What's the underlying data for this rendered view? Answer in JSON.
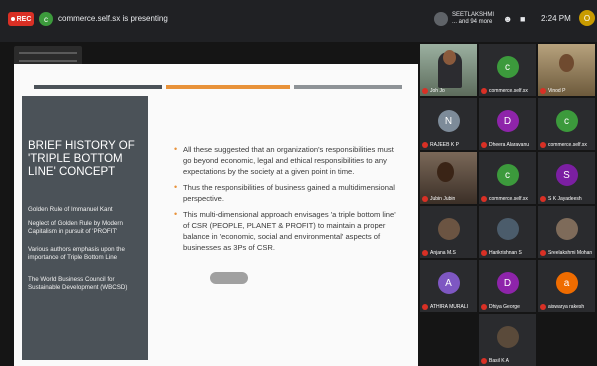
{
  "topbar": {
    "rec_label": "REC",
    "presenter_initial": "c",
    "presenting_text": "commerce.self.sx is presenting",
    "me_name": "SEETLAKSHMI ... and 94 more",
    "time": "2:24 PM",
    "corner_initial": "O"
  },
  "slide": {
    "title": "BRIEF HISTORY OF 'TRIPLE BOTTOM LINE' CONCEPT",
    "left_items": [
      "Golden Rule of Immanuel Kant",
      "Neglect of Golden Rule by Modern Capitalism in pursuit of 'PROFIT'",
      "Various authors emphasis upon the importance of Triple Bottom Line",
      "The World Business Council for Sustainable Development (WBCSD)"
    ],
    "bullets": [
      "All these suggested that an organization's responsibilities must go beyond economic, legal and ethical responsibilities to any expectations by the society at a given point in time.",
      "Thus the responsibilities of business gained a multidimensional perspective.",
      "This multi-dimensional approach envisages 'a triple bottom line' of CSR (PEOPLE, PLANET & PROFIT) to maintain a proper balance in 'economic, social and environmental' aspects of businesses as 3Ps of CSR."
    ]
  },
  "participants": [
    {
      "name": "Joh Jo",
      "initial": "",
      "color": "#000000",
      "video": "video1"
    },
    {
      "name": "commerce.self.sx",
      "initial": "c",
      "color": "#3c9a3c",
      "video": ""
    },
    {
      "name": "Vinod P",
      "initial": "",
      "color": "#000000",
      "video": "video2"
    },
    {
      "name": "RAJEEB K P",
      "initial": "N",
      "color": "#7d8b99",
      "video": ""
    },
    {
      "name": "Dheera Alaravanu",
      "initial": "D",
      "color": "#8e24aa",
      "video": ""
    },
    {
      "name": "commerce.self.sx",
      "initial": "c",
      "color": "#3c9a3c",
      "video": ""
    },
    {
      "name": "Jubin Jubin",
      "initial": "",
      "color": "#000000",
      "video": "video3"
    },
    {
      "name": "commerce.self.sx",
      "initial": "c",
      "color": "#3c9a3c",
      "video": ""
    },
    {
      "name": "S K Jayadeesh",
      "initial": "S",
      "color": "#7b1fa2",
      "video": ""
    },
    {
      "name": "Anjana M.S",
      "initial": "",
      "color": "#6b5442",
      "video": "photo"
    },
    {
      "name": "Harikrishnan S",
      "initial": "",
      "color": "#4b5c6b",
      "video": "photo"
    },
    {
      "name": "Sreelakshmi Mohan",
      "initial": "",
      "color": "#7e6b5a",
      "video": "photo"
    },
    {
      "name": "ATHIRA MURALI",
      "initial": "A",
      "color": "#7e57c2",
      "video": ""
    },
    {
      "name": "Dhiya George",
      "initial": "D",
      "color": "#8e24aa",
      "video": ""
    },
    {
      "name": "aiswarya rakesh",
      "initial": "a",
      "color": "#ef6c00",
      "video": ""
    },
    {
      "name": "Basil K A",
      "initial": "",
      "color": "#5a4a3a",
      "video": "photo"
    }
  ]
}
